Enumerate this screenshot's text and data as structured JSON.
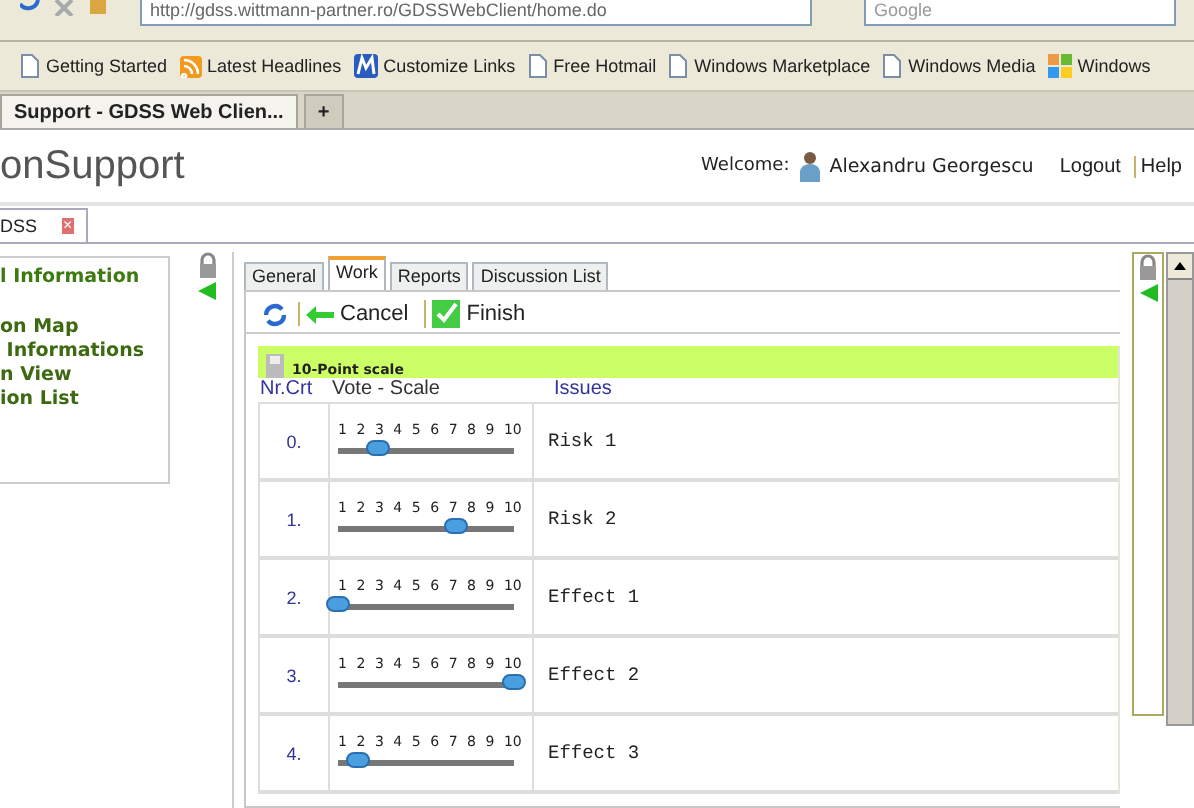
{
  "browser": {
    "url": "http://gdss.wittmann-partner.ro/GDSSWebClient/home.do",
    "search_placeholder": "Google",
    "bookmarks": [
      {
        "label": "Getting Started",
        "kind": "page"
      },
      {
        "label": "Latest Headlines",
        "kind": "feed"
      },
      {
        "label": "Customize Links",
        "kind": "m"
      },
      {
        "label": "Free Hotmail",
        "kind": "page"
      },
      {
        "label": "Windows Marketplace",
        "kind": "page"
      },
      {
        "label": "Windows Media",
        "kind": "page"
      },
      {
        "label": "Windows",
        "kind": "windows"
      }
    ],
    "tabs": [
      {
        "label": "Support - GDSS Web Clien...",
        "selected": true
      },
      {
        "label": "+",
        "selected": false
      }
    ]
  },
  "header": {
    "title": "onSupport",
    "welcome": "Welcome:",
    "user": "Alexandru Georgescu",
    "links": [
      "Logout",
      "Help"
    ]
  },
  "doc_tabs": [
    {
      "label": "DSS",
      "close": "×"
    }
  ],
  "sidebar": {
    "items": [
      {
        "label": "l Information",
        "selected": true
      },
      {
        "label": "on Map",
        "selected": false
      },
      {
        "label": " Informations",
        "selected": false
      },
      {
        "label": "n View",
        "selected": false
      },
      {
        "label": "ion List",
        "selected": false
      }
    ]
  },
  "tabs": [
    {
      "label": "General",
      "selected": false
    },
    {
      "label": "Work",
      "selected": true
    },
    {
      "label": "Reports",
      "selected": false
    },
    {
      "label": "Discussion List",
      "selected": false
    }
  ],
  "toolbar": {
    "buttons": [
      "Cancel",
      "Finish"
    ]
  },
  "grid": {
    "title": "10-Point scale",
    "columns": [
      "Nr.Crt",
      "Vote - Scale",
      "Issues"
    ],
    "rows": [
      {
        "nr": "0.",
        "ticks": [
          "1",
          "2",
          "3",
          "4",
          "5",
          "6",
          "7",
          "8",
          "9",
          "10"
        ],
        "level": 0.222,
        "issue": "Risk 1"
      },
      {
        "nr": "1.",
        "ticks": [
          "1",
          "2",
          "3",
          "4",
          "5",
          "6",
          "7",
          "8",
          "9",
          "10"
        ],
        "level": 0.667,
        "issue": "Risk 2"
      },
      {
        "nr": "2.",
        "ticks": [
          "1",
          "2",
          "3",
          "4",
          "5",
          "6",
          "7",
          "8",
          "9",
          "10"
        ],
        "level": 0,
        "issue": "Effect 1"
      },
      {
        "nr": "3.",
        "ticks": [
          "1",
          "2",
          "3",
          "4",
          "5",
          "6",
          "7",
          "8",
          "9",
          "10"
        ],
        "level": 1,
        "issue": "Effect 2"
      },
      {
        "nr": "4.",
        "ticks": [
          "1",
          "2",
          "3",
          "4",
          "5",
          "6",
          "7",
          "8",
          "9",
          "10"
        ],
        "level": 0.111,
        "issue": "Effect 3"
      }
    ]
  }
}
